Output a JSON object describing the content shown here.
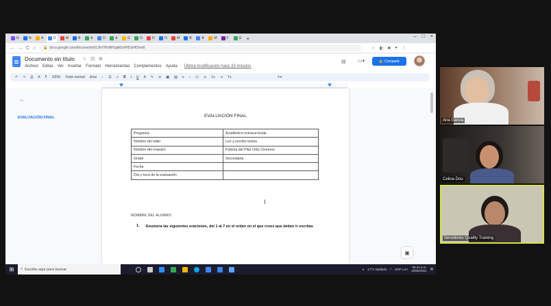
{
  "browser": {
    "tabs": [
      {
        "label": "N",
        "color": "#7c4dff"
      },
      {
        "label": "N",
        "color": "#1a73e8"
      },
      {
        "label": "A",
        "color": "#f9ab00"
      },
      {
        "label": "D",
        "color": "#4285f4"
      },
      {
        "label": "M",
        "color": "#ea4335"
      },
      {
        "label": "B",
        "color": "#1a73e8"
      },
      {
        "label": "A",
        "color": "#34a853"
      },
      {
        "label": "D",
        "color": "#4285f4"
      },
      {
        "label": "A",
        "color": "#34a853"
      },
      {
        "label": "G",
        "color": "#fbbc04"
      },
      {
        "label": "O",
        "color": "#34a853"
      },
      {
        "label": "D",
        "color": "#ea4335"
      },
      {
        "label": "O",
        "color": "#1a73e8"
      },
      {
        "label": "M",
        "color": "#ea4335"
      },
      {
        "label": "B",
        "color": "#1a73e8"
      },
      {
        "label": "B",
        "color": "#4285f4"
      },
      {
        "label": "M",
        "color": "#f9ab00"
      },
      {
        "label": "F",
        "color": "#7b1fa2"
      },
      {
        "label": "G",
        "color": "#34a853"
      }
    ],
    "new_tab": "+",
    "url": "docs.google.com/document/d/1JfsYHrdWVgdkDoPtDuiHD/edit"
  },
  "doc": {
    "title": "Documento sin título",
    "title_icons": "☆ ⊡ ⊘",
    "menu": [
      "Archivo",
      "Editar",
      "Ver",
      "Insertar",
      "Formato",
      "Herramientas",
      "Complementos",
      "Ayuda"
    ],
    "last_edit": "Última modificación hace 33 minutos",
    "share_label": "Compartir",
    "toolbar": {
      "zoom": "100%",
      "style": "Texto normal",
      "font": "Arial",
      "size": "11"
    },
    "outline_item": "EVALUACIÓN FINAL",
    "eval_title": "EVALUACIÓN FINAL",
    "table": [
      [
        "Programa",
        "Académico extracurricular"
      ],
      [
        "Nombre del taller",
        "Leo y escribo textos"
      ],
      [
        "Nombre del maestro",
        "Patricia del Pilar Ortiz Cisneros"
      ],
      [
        "Grado",
        "Secundaria"
      ],
      [
        "Fecha",
        ""
      ],
      [
        "Día y hora de la evaluación",
        ""
      ]
    ],
    "student_label": "NOMBRE DEL ALUMNO:",
    "instruction_number": "1.",
    "instruction_text": "Enumera las siguientes oraciones, del 1 al 7 en el orden en el que crees que deben ir escritas"
  },
  "taskbar": {
    "search_placeholder": "Escribe aquí para buscar",
    "weather": "17°C Nublado",
    "language": "ESP LAA",
    "time": "08:44 a.m.",
    "date": "23/06/2021"
  },
  "participants": [
    {
      "name": "Ana García"
    },
    {
      "name": "Celina Dou"
    },
    {
      "name": "Servidores Quality Training"
    }
  ]
}
